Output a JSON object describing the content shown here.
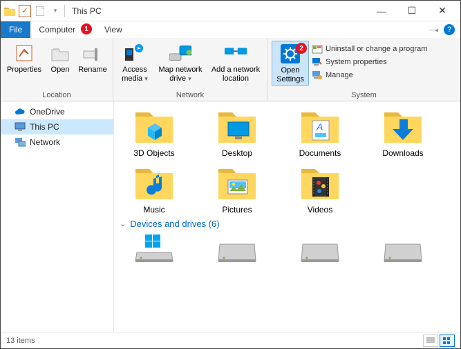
{
  "window": {
    "title": "This PC",
    "item_count_text": "13 items"
  },
  "window_controls": {
    "minimize": "—",
    "maximize": "☐",
    "close": "✕"
  },
  "tabs": {
    "file": "File",
    "computer": "Computer",
    "view": "View"
  },
  "annotations": {
    "badge1": "1",
    "badge2": "2"
  },
  "ribbon": {
    "groups": {
      "location": {
        "label": "Location",
        "items": {
          "properties": "Properties",
          "open": "Open",
          "rename": "Rename"
        }
      },
      "network": {
        "label": "Network",
        "items": {
          "access_media": "Access media",
          "map_drive": "Map network drive",
          "add_location": "Add a network location"
        }
      },
      "system": {
        "label": "System",
        "items": {
          "open_settings": "Open Settings",
          "uninstall": "Uninstall or change a program",
          "sys_properties": "System properties",
          "manage": "Manage"
        }
      }
    }
  },
  "sidebar": {
    "items": [
      {
        "label": "OneDrive",
        "icon": "cloud"
      },
      {
        "label": "This PC",
        "icon": "pc",
        "selected": true
      },
      {
        "label": "Network",
        "icon": "network"
      }
    ]
  },
  "content": {
    "folders": [
      {
        "label": "3D Objects"
      },
      {
        "label": "Desktop"
      },
      {
        "label": "Documents"
      },
      {
        "label": "Downloads"
      },
      {
        "label": "Music"
      },
      {
        "label": "Pictures"
      },
      {
        "label": "Videos"
      }
    ],
    "devices_header": "Devices and drives (6)"
  }
}
